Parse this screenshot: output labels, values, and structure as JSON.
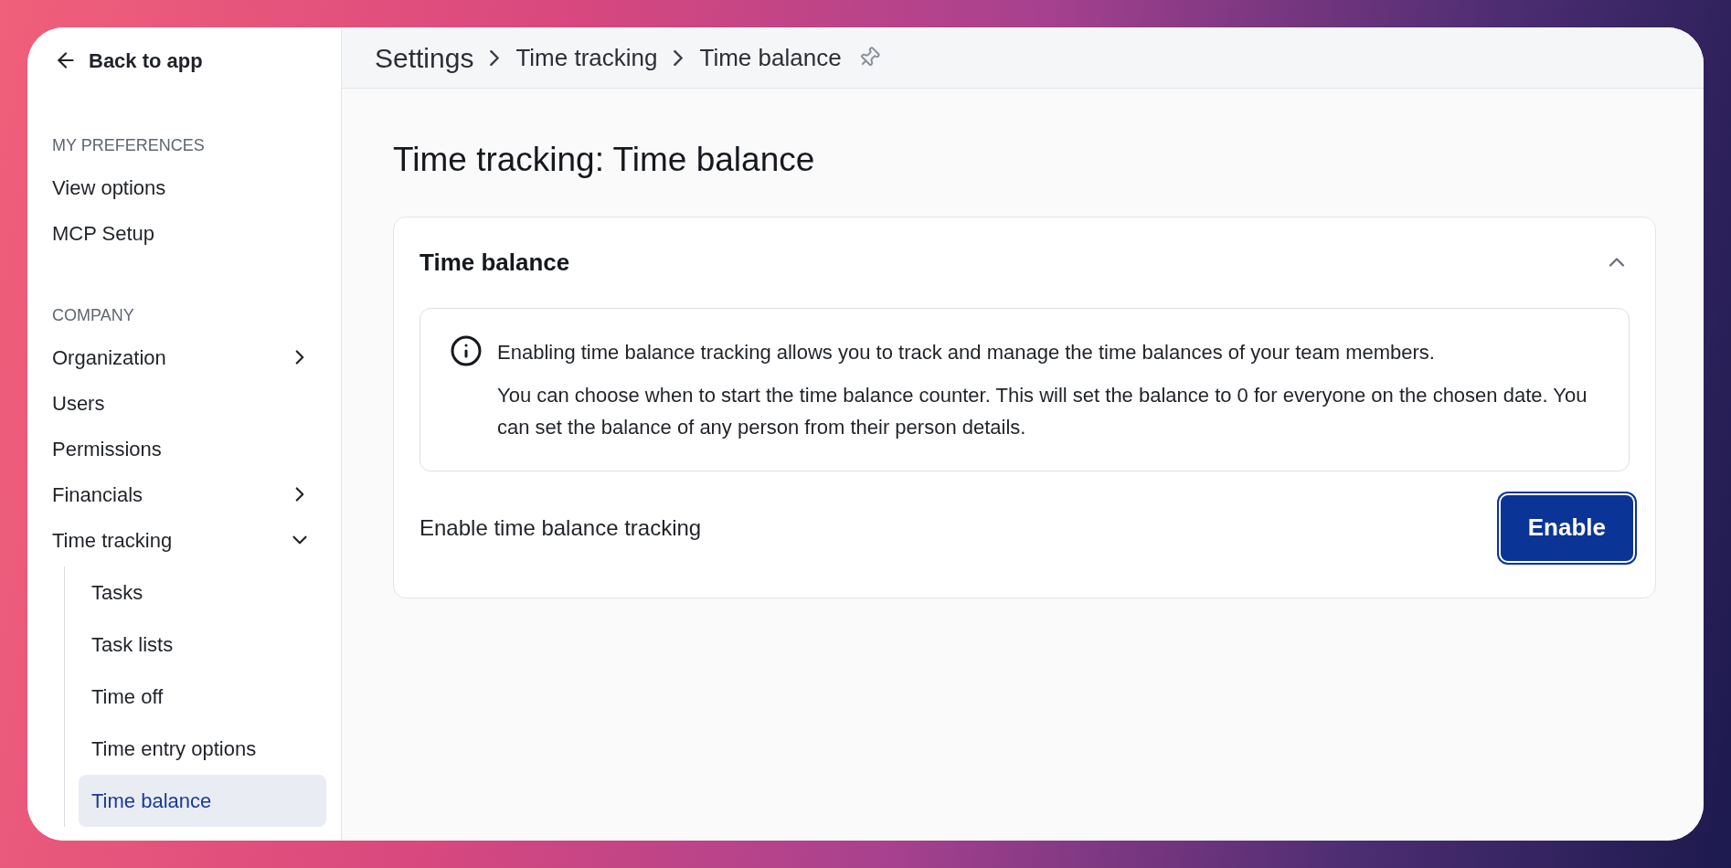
{
  "back_link": {
    "label": "Back to app"
  },
  "sidebar": {
    "sections": [
      {
        "heading": "MY PREFERENCES",
        "items": [
          {
            "label": "View options",
            "selected": false
          },
          {
            "label": "MCP Setup",
            "selected": false
          }
        ]
      },
      {
        "heading": "COMPANY",
        "items": [
          {
            "label": "Organization",
            "selected": false,
            "expanded": false
          },
          {
            "label": "Users",
            "selected": false
          },
          {
            "label": "Permissions",
            "selected": false
          },
          {
            "label": "Financials",
            "selected": false,
            "expanded": false
          },
          {
            "label": "Time tracking",
            "selected": false,
            "expanded": true,
            "children": [
              {
                "label": "Tasks",
                "selected": false
              },
              {
                "label": "Task lists",
                "selected": false
              },
              {
                "label": "Time off",
                "selected": false
              },
              {
                "label": "Time entry options",
                "selected": false
              },
              {
                "label": "Time balance",
                "selected": true
              }
            ]
          }
        ]
      }
    ]
  },
  "breadcrumb": {
    "items": [
      "Settings",
      "Time tracking",
      "Time balance"
    ],
    "pinned": false
  },
  "page_title": "Time tracking: Time balance",
  "card": {
    "title": "Time balance",
    "expanded": true,
    "info": [
      "Enabling time balance tracking allows you to track and manage the time balances of your team members.",
      "You can choose when to start the time balance counter. This will set the balance to 0 for everyone on the chosen date. You can set the balance of any person from their person details."
    ],
    "setting_label": "Enable time balance tracking",
    "button": "Enable"
  }
}
